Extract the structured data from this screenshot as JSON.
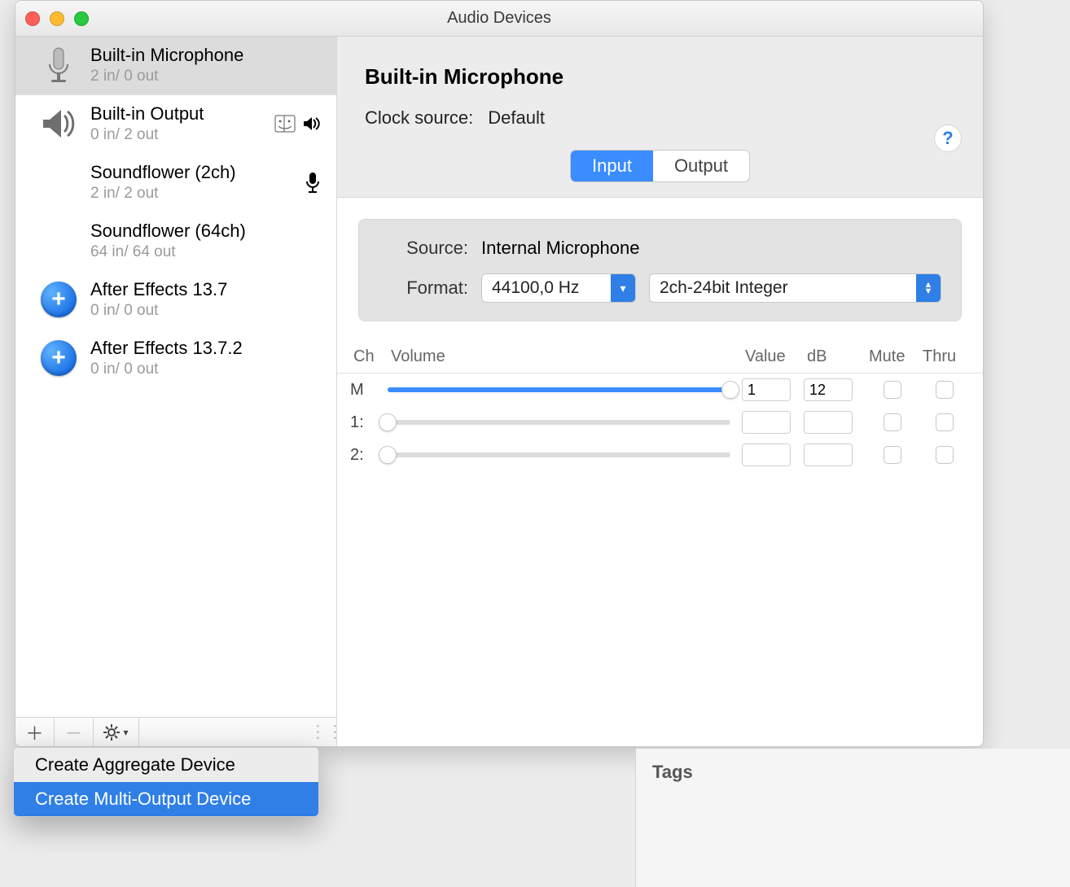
{
  "window": {
    "title": "Audio Devices"
  },
  "sidebar": {
    "devices": [
      {
        "name": "Built-in Microphone",
        "io": "2 in/ 0 out",
        "icon": "microphone",
        "selected": true
      },
      {
        "name": "Built-in Output",
        "io": "0 in/ 2 out",
        "icon": "speaker",
        "system_out": true
      },
      {
        "name": "Soundflower (2ch)",
        "io": "2 in/ 2 out",
        "icon": "none",
        "system_in": true
      },
      {
        "name": "Soundflower (64ch)",
        "io": "64 in/ 64 out",
        "icon": "none"
      },
      {
        "name": "After Effects 13.7",
        "io": "0 in/ 0 out",
        "icon": "plus"
      },
      {
        "name": "After Effects 13.7.2",
        "io": "0 in/ 0 out",
        "icon": "plus"
      }
    ]
  },
  "popup": {
    "items": [
      {
        "label": "Create Aggregate Device",
        "hover": false
      },
      {
        "label": "Create Multi-Output Device",
        "hover": true
      }
    ]
  },
  "detail": {
    "name": "Built-in Microphone",
    "clock_label": "Clock source:",
    "clock_value": "Default",
    "tabs": {
      "input": "Input",
      "output": "Output",
      "active": "input"
    },
    "source_label": "Source:",
    "source_value": "Internal Microphone",
    "format_label": "Format:",
    "format_rate": "44100,0 Hz",
    "format_fmt": "2ch-24bit Integer",
    "table": {
      "headers": {
        "ch": "Ch",
        "volume": "Volume",
        "value": "Value",
        "db": "dB",
        "mute": "Mute",
        "thru": "Thru"
      },
      "rows": [
        {
          "ch": "M",
          "pos": 1.0,
          "value": "1",
          "db": "12"
        },
        {
          "ch": "1:",
          "pos": 0.0,
          "value": "",
          "db": ""
        },
        {
          "ch": "2:",
          "pos": 0.0,
          "value": "",
          "db": ""
        }
      ]
    }
  },
  "tags": {
    "title": "Tags"
  }
}
